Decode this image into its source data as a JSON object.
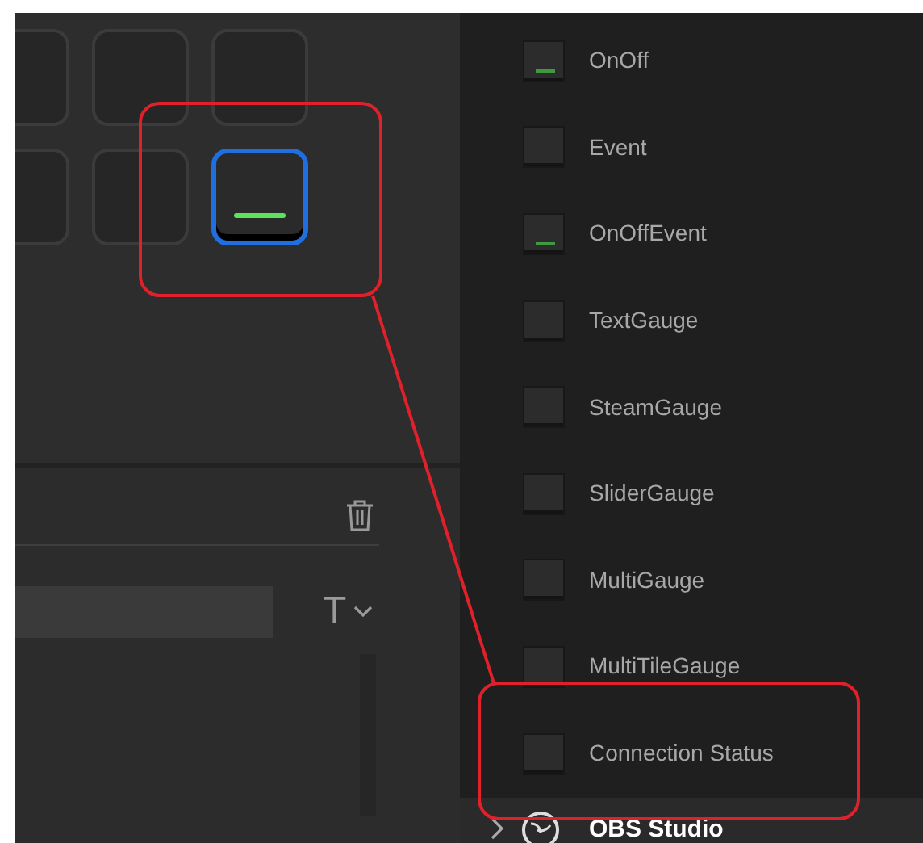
{
  "key_grid": [
    {
      "selected": false,
      "lit": false
    },
    {
      "selected": false,
      "lit": false
    },
    {
      "selected": false,
      "lit": false
    },
    {
      "selected": false,
      "lit": false
    },
    {
      "selected": false,
      "lit": false
    },
    {
      "selected": true,
      "lit": true
    }
  ],
  "settings": {
    "font_button": "T"
  },
  "actions": [
    {
      "label": "OnOff",
      "lit": true
    },
    {
      "label": "Event",
      "lit": false
    },
    {
      "label": "OnOffEvent",
      "lit": true
    },
    {
      "label": "TextGauge",
      "lit": false
    },
    {
      "label": "SteamGauge",
      "lit": false
    },
    {
      "label": "SliderGauge",
      "lit": false
    },
    {
      "label": "MultiGauge",
      "lit": false
    },
    {
      "label": "MultiTileGauge",
      "lit": false
    },
    {
      "label": "Connection Status",
      "lit": false
    }
  ],
  "next_group": {
    "label": "OBS Studio",
    "expanded": false
  }
}
